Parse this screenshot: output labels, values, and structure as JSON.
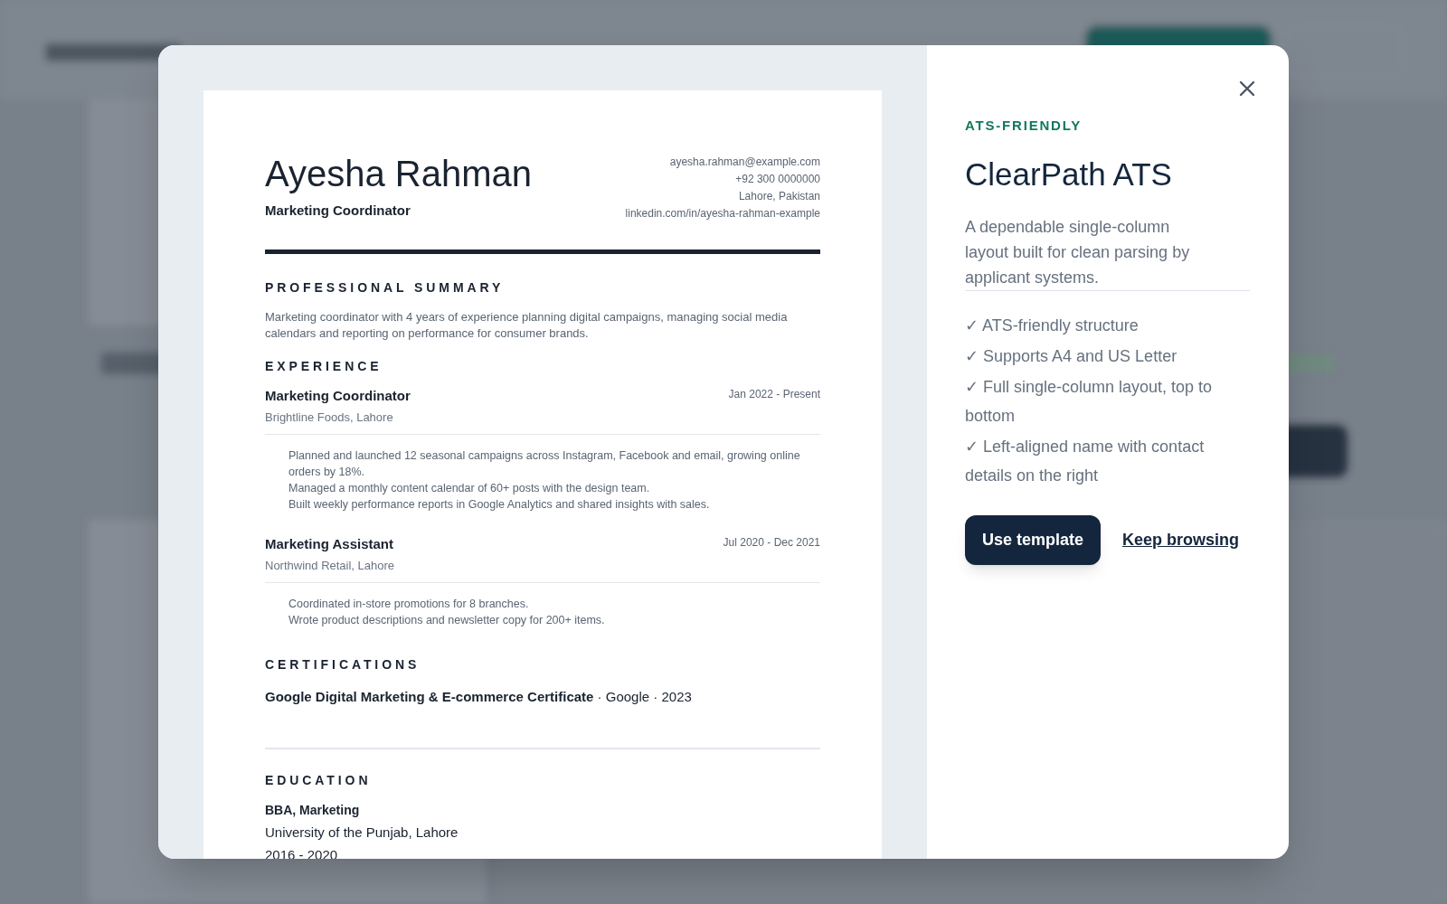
{
  "resume": {
    "name": "Ayesha Rahman",
    "headline": "Marketing Coordinator",
    "contact": [
      "ayesha.rahman@example.com",
      "+92 300 0000000",
      "Lahore, Pakistan",
      "linkedin.com/in/ayesha-rahman-example"
    ],
    "summary": {
      "heading": "PROFESSIONAL SUMMARY",
      "text": "Marketing coordinator with 4 years of experience planning digital campaigns, managing social media calendars and reporting on performance for consumer brands."
    },
    "experience": {
      "heading": "EXPERIENCE",
      "jobs": [
        {
          "title": "Marketing Coordinator",
          "company": "Brightline Foods, Lahore",
          "dates": "Jan 2022 - Present",
          "bullets": [
            "Planned and launched 12 seasonal campaigns across Instagram, Facebook and email, growing online orders by 18%.",
            "Managed a monthly content calendar of 60+ posts with the design team.",
            "Built weekly performance reports in Google Analytics and shared insights with sales."
          ]
        },
        {
          "title": "Marketing Assistant",
          "company": "Northwind Retail, Lahore",
          "dates": "Jul 2020 - Dec 2021",
          "bullets": [
            "Coordinated in-store promotions for 8 branches.",
            "Wrote product descriptions and newsletter copy for 200+ items."
          ]
        }
      ]
    },
    "certifications": {
      "heading": "CERTIFICATIONS",
      "items": [
        "**Google Digital Marketing & E-commerce Certificate** · Google · 2023"
      ]
    },
    "education": {
      "heading": "EDUCATION",
      "degree": "BBA, Marketing",
      "school": "University of the Punjab, Lahore",
      "years": "2016 - 2020"
    }
  },
  "details": {
    "tag": "ATS-FRIENDLY",
    "title": "ClearPath ATS",
    "description": "A dependable single-column layout built for clean parsing by applicant systems.",
    "features": [
      "✓ ATS-friendly structure",
      "✓ Supports A4 and US Letter",
      "✓ Full single-column layout, top to bottom",
      "✓ Left-aligned name with contact details on the right"
    ],
    "primary_button": "Use template",
    "secondary_link": "Keep browsing"
  }
}
